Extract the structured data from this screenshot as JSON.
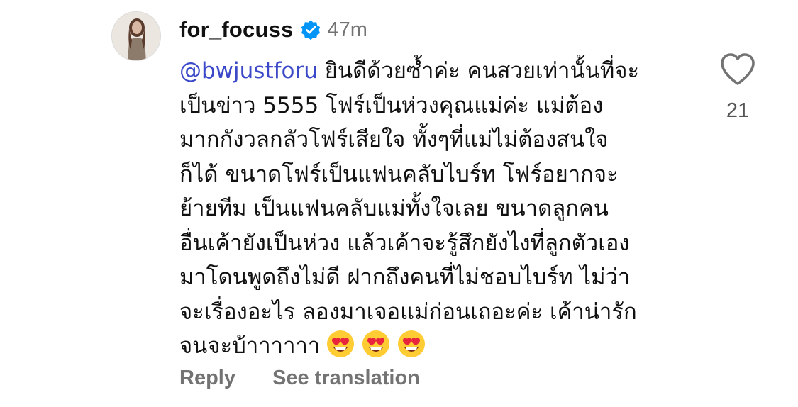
{
  "comment": {
    "username": "for_focuss",
    "time": "47m",
    "mention": "@bwjustforu",
    "line1_rest": " ยินดีด้วยซ้ำค่ะ คนสวยเท่านั้นที่จะ",
    "lines": [
      "เป็นข่าว 5555 โฟร์เป็นห่วงคุณแม่ค่ะ แม่ต้อง",
      "มากกังวลกลัวโฟร์เสียใจ ทั้งๆที่แม่ไม่ต้องสนใจ",
      "ก็ได้ ขนาดโฟร์เป็นแฟนคลับไบร์ท โฟร์อยากจะ",
      "ย้ายทีม เป็นแฟนคลับแม่ทั้งใจเลย ขนาดลูกคน",
      "อื่นเค้ายังเป็นห่วง แล้วเค้าจะรู้สึกยังไงที่ลูกตัวเอง",
      "มาโดนพูดถึงไม่ดี ฝากถึงคนที่ไม่ชอบไบร์ท ไม่ว่า",
      "จะเรื่องอะไร ลองมาเจอแม่ก่อนเถอะค่ะ เค้าน่ารัก"
    ],
    "last_line": "จนจะบ้าาาาาา",
    "emojis": [
      "heart-eyes-emoji",
      "heart-eyes-emoji",
      "heart-eyes-emoji"
    ],
    "reply_label": "Reply",
    "translate_label": "See translation",
    "like_count": "21"
  },
  "colors": {
    "mention": "#3b49c8",
    "verified": "#0095f6",
    "secondary_text": "#737373"
  },
  "icons": {
    "verified": "verified-badge-icon",
    "like": "heart-outline-icon"
  }
}
